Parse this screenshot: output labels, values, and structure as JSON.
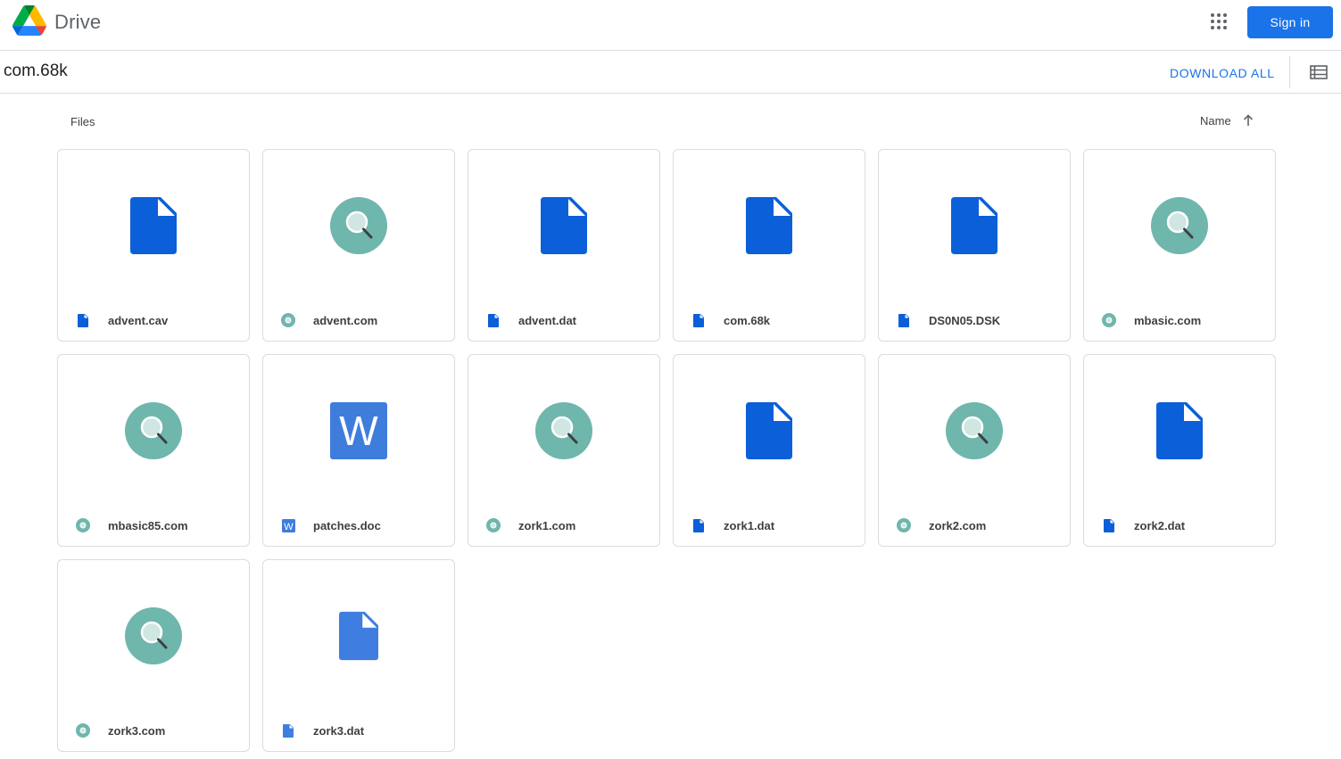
{
  "app": {
    "brand": "Drive",
    "signin_label": "Sign in"
  },
  "folder": {
    "title": "com.68k",
    "download_all_label": "DOWNLOAD ALL"
  },
  "section": {
    "files_label": "Files",
    "sort_label": "Name"
  },
  "colors": {
    "doc_blue": "#0b5fd8",
    "cd_teal": "#6fb6ad",
    "word_blue": "#3e7ddc",
    "accent": "#1a73e8"
  },
  "files": [
    {
      "name": "advent.cav",
      "icon": "file-icon"
    },
    {
      "name": "advent.com",
      "icon": "disc-icon"
    },
    {
      "name": "advent.dat",
      "icon": "file-icon"
    },
    {
      "name": "com.68k",
      "icon": "file-icon"
    },
    {
      "name": "DS0N05.DSK",
      "icon": "file-icon"
    },
    {
      "name": "mbasic.com",
      "icon": "disc-icon"
    },
    {
      "name": "mbasic85.com",
      "icon": "disc-icon"
    },
    {
      "name": "patches.doc",
      "icon": "word-icon"
    },
    {
      "name": "zork1.com",
      "icon": "disc-icon"
    },
    {
      "name": "zork1.dat",
      "icon": "file-icon"
    },
    {
      "name": "zork2.com",
      "icon": "disc-icon"
    },
    {
      "name": "zork2.dat",
      "icon": "file-icon"
    },
    {
      "name": "zork3.com",
      "icon": "disc-icon"
    },
    {
      "name": "zork3.dat",
      "icon": "file-light-icon"
    }
  ]
}
